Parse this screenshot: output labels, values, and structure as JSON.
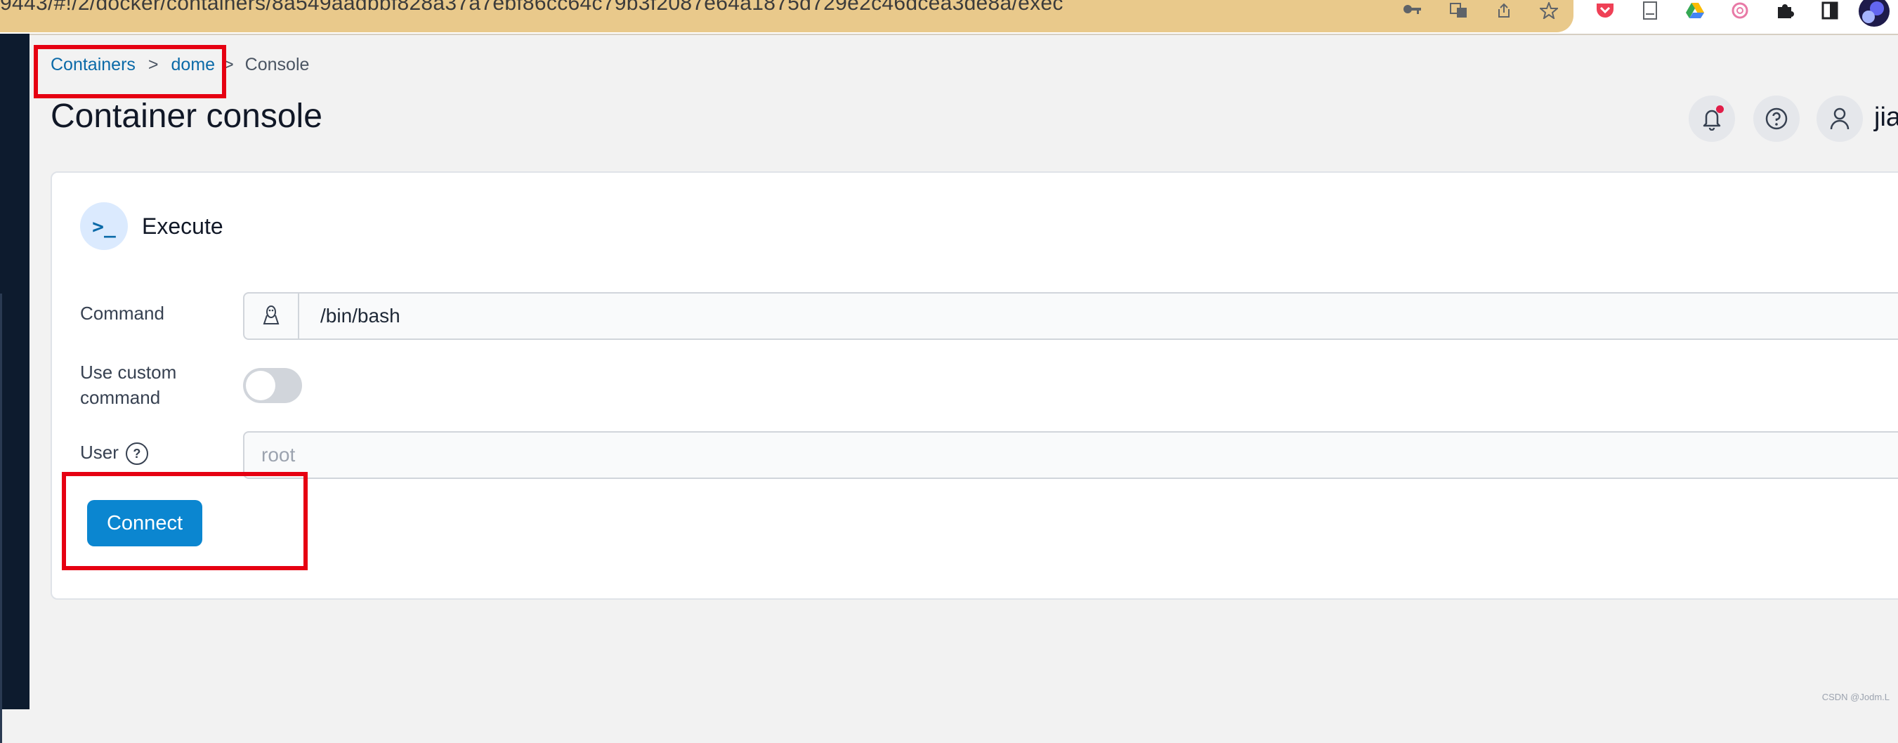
{
  "browser": {
    "url": "9443/#!/2/docker/containers/8a549aadbbf828a37a7ebf86cc64c79b3f2087e64a1875d729e2c46dcea3de8a/exec",
    "icons": [
      "key-icon",
      "translate-icon",
      "share-icon",
      "star-icon",
      "pocket-icon",
      "reading-list-icon",
      "drive-icon",
      "openai-icon",
      "extensions-icon",
      "sidepanel-icon",
      "profile-avatar"
    ]
  },
  "breadcrumb": {
    "containers": "Containers",
    "sep1": ">",
    "container": "dome",
    "sep2": ">",
    "current": "Console"
  },
  "page": {
    "title": "Container console",
    "username": "jia"
  },
  "card": {
    "title": "Execute",
    "command_label": "Command",
    "command_value": "/bin/bash",
    "custom_label_line1": "Use custom",
    "custom_label_line2": "command",
    "custom_enabled": false,
    "user_label": "User",
    "user_help": "?",
    "user_placeholder": "root",
    "connect_label": "Connect"
  },
  "watermark": "CSDN @Jodm.L",
  "colors": {
    "accent": "#0b86d0",
    "link": "#0b6aa8",
    "highlight": "#e60012",
    "notification": "#e11d48"
  }
}
